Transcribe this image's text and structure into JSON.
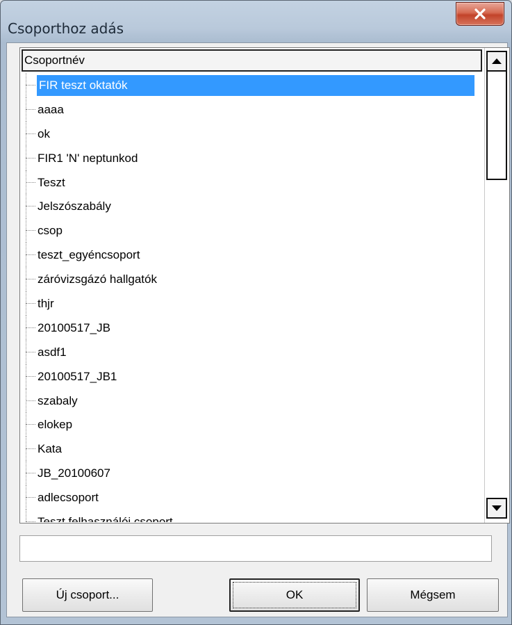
{
  "window": {
    "title": "Csoporthoz adás",
    "close_icon": "close-icon"
  },
  "list": {
    "column_header": "Csoportnév",
    "selected_index": 0,
    "items": [
      "FIR teszt oktatók",
      "aaaa",
      "ok",
      "FIR1 'N' neptunkod",
      "Teszt",
      "Jelszószabály",
      "csop",
      "teszt_egyéncsoport",
      "záróvizsgázó hallgatók",
      "thjr",
      "20100517_JB",
      "asdf1",
      "20100517_JB1",
      "szabaly",
      "elokep",
      "Kata",
      "JB_20100607",
      "adlecsoport",
      "Teszt felhasználói csoport"
    ]
  },
  "input": {
    "value": ""
  },
  "buttons": {
    "new_group": "Új csoport...",
    "ok": "OK",
    "cancel": "Mégsem"
  },
  "colors": {
    "selection": "#3399ff",
    "close_button": "#c2432a"
  }
}
